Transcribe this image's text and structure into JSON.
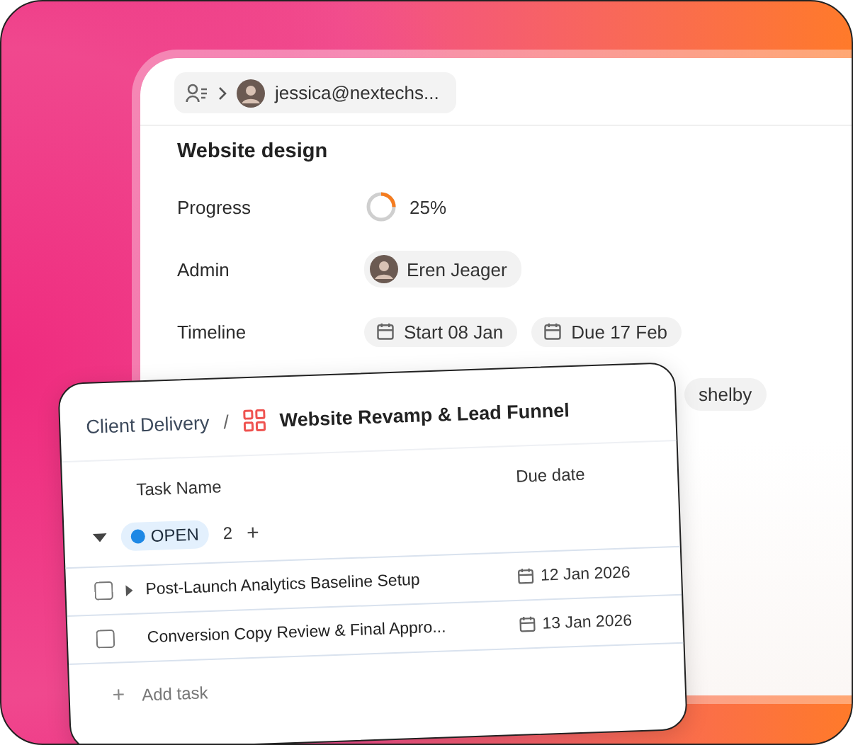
{
  "back_panel": {
    "breadcrumb_user": "jessica@nextechs...",
    "title": "Website design",
    "fields": [
      {
        "kind": "progress",
        "label": "Progress",
        "value": "25%"
      },
      {
        "kind": "person",
        "label": "Admin",
        "value": "Eren Jeager"
      },
      {
        "kind": "dates",
        "label": "Timeline",
        "start": "Start 08 Jan",
        "due": "Due 17 Feb"
      }
    ],
    "partial_chip": "shelby"
  },
  "front_card": {
    "space": "Client Delivery",
    "separator": "/",
    "list_name": "Website Revamp & Lead Funnel",
    "columns": [
      "Task Name",
      "Due date"
    ],
    "group": {
      "status": "OPEN",
      "color": "#1e88e5",
      "count": "2",
      "add": "+",
      "expanded": true
    },
    "tasks": [
      {
        "name": "Post-Launch Analytics Baseline Setup",
        "due": "12 Jan 2026",
        "checked": false,
        "has_subtasks": true
      },
      {
        "name": "Conversion Copy Review & Final Appro...",
        "due": "13 Jan 2026",
        "checked": false,
        "has_subtasks": false
      }
    ],
    "add_task": {
      "icon": "+",
      "label": "Add task"
    }
  }
}
